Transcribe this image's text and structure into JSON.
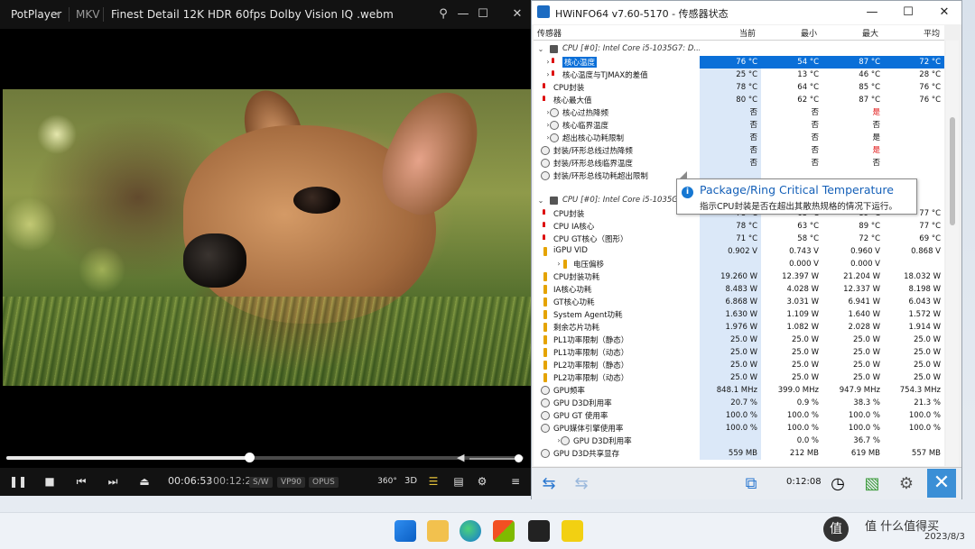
{
  "potplayer": {
    "brand": "PotPlayer",
    "format": "MKV",
    "filename": "Finest Detail 12K HDR 60fps  Dolby Vision IQ .webm",
    "time_current": "00:06:53",
    "time_total": "00:12:26",
    "tags": [
      "S/W",
      "VP90",
      "OPUS"
    ],
    "seek_fraction": 0.47,
    "volume_fraction": 1.0,
    "labels": {
      "vr": "360°",
      "td": "3D"
    }
  },
  "hwinfo": {
    "title": "HWiNFO64 v7.60-5170 - 传感器状态",
    "columns": {
      "sensor": "传感器",
      "current": "当前",
      "min": "最小",
      "max": "最大",
      "avg": "平均"
    },
    "group1": "CPU [#0]: Intel Core i5-1035G7: D...",
    "group2": "CPU [#0]: Intel Core i5-1035G",
    "rows_a": [
      {
        "label": "核心温度",
        "cur": "76 °C",
        "min": "54 °C",
        "max": "87 °C",
        "avg": "72 °C",
        "sel": true,
        "icon": "therm",
        "exp": true
      },
      {
        "label": "核心温度与TJMAX的差值",
        "cur": "25 °C",
        "min": "13 °C",
        "max": "46 °C",
        "avg": "28 °C",
        "icon": "therm",
        "exp": true
      },
      {
        "label": "CPU封装",
        "cur": "78 °C",
        "min": "64 °C",
        "max": "85 °C",
        "avg": "76 °C",
        "icon": "therm"
      },
      {
        "label": "核心最大值",
        "cur": "80 °C",
        "min": "62 °C",
        "max": "87 °C",
        "avg": "76 °C",
        "icon": "therm"
      },
      {
        "label": "核心过热降频",
        "cur": "否",
        "min": "否",
        "max": "是",
        "avg": "",
        "icon": "circle",
        "exp": true,
        "maxRed": true
      },
      {
        "label": "核心临界温度",
        "cur": "否",
        "min": "否",
        "max": "否",
        "avg": "",
        "icon": "circle",
        "exp": true
      },
      {
        "label": "超出核心功耗限制",
        "cur": "否",
        "min": "否",
        "max": "是",
        "avg": "",
        "icon": "circle",
        "exp": true
      },
      {
        "label": "封装/环形总线过热降频",
        "cur": "否",
        "min": "否",
        "max": "是",
        "avg": "",
        "icon": "circle",
        "maxRed": true
      },
      {
        "label": "封装/环形总线临界温度",
        "cur": "否",
        "min": "否",
        "max": "否",
        "avg": "",
        "icon": "circle"
      },
      {
        "label": "封装/环形总线功耗超出限制",
        "cur": "",
        "min": "",
        "max": "",
        "avg": "",
        "icon": "circle"
      }
    ],
    "rows_b": [
      {
        "label": "CPU封装",
        "cur": "78 °C",
        "min": "63 °C",
        "max": "89 °C",
        "avg": "77 °C",
        "icon": "therm"
      },
      {
        "label": "CPU IA核心",
        "cur": "78 °C",
        "min": "63 °C",
        "max": "89 °C",
        "avg": "77 °C",
        "icon": "therm"
      },
      {
        "label": "CPU GT核心（图形）",
        "cur": "71 °C",
        "min": "58 °C",
        "max": "72 °C",
        "avg": "69 °C",
        "icon": "therm"
      },
      {
        "label": "iGPU VID",
        "cur": "0.902 V",
        "min": "0.743 V",
        "max": "0.960 V",
        "avg": "0.868 V",
        "icon": "bolt"
      },
      {
        "label": "电压偏移",
        "cur": "",
        "min": "0.000 V",
        "max": "0.000 V",
        "avg": "",
        "icon": "bolt",
        "exp": true,
        "indent": true
      },
      {
        "label": "CPU封装功耗",
        "cur": "19.260 W",
        "min": "12.397 W",
        "max": "21.204 W",
        "avg": "18.032 W",
        "icon": "bolt"
      },
      {
        "label": "IA核心功耗",
        "cur": "8.483 W",
        "min": "4.028 W",
        "max": "12.337 W",
        "avg": "8.198 W",
        "icon": "bolt"
      },
      {
        "label": "GT核心功耗",
        "cur": "6.868 W",
        "min": "3.031 W",
        "max": "6.941 W",
        "avg": "6.043 W",
        "icon": "bolt"
      },
      {
        "label": "System Agent功耗",
        "cur": "1.630 W",
        "min": "1.109 W",
        "max": "1.640 W",
        "avg": "1.572 W",
        "icon": "bolt"
      },
      {
        "label": "剩余芯片功耗",
        "cur": "1.976 W",
        "min": "1.082 W",
        "max": "2.028 W",
        "avg": "1.914 W",
        "icon": "bolt"
      },
      {
        "label": "PL1功率限制（静态）",
        "cur": "25.0 W",
        "min": "25.0 W",
        "max": "25.0 W",
        "avg": "25.0 W",
        "icon": "bolt"
      },
      {
        "label": "PL1功率限制（动态）",
        "cur": "25.0 W",
        "min": "25.0 W",
        "max": "25.0 W",
        "avg": "25.0 W",
        "icon": "bolt"
      },
      {
        "label": "PL2功率限制（静态）",
        "cur": "25.0 W",
        "min": "25.0 W",
        "max": "25.0 W",
        "avg": "25.0 W",
        "icon": "bolt"
      },
      {
        "label": "PL2功率限制（动态）",
        "cur": "25.0 W",
        "min": "25.0 W",
        "max": "25.0 W",
        "avg": "25.0 W",
        "icon": "bolt"
      },
      {
        "label": "GPU频率",
        "cur": "848.1 MHz",
        "min": "399.0 MHz",
        "max": "947.9 MHz",
        "avg": "754.3 MHz",
        "icon": "circle"
      },
      {
        "label": "GPU D3D利用率",
        "cur": "20.7 %",
        "min": "0.9 %",
        "max": "38.3 %",
        "avg": "21.3 %",
        "icon": "circle"
      },
      {
        "label": "GPU GT 使用率",
        "cur": "100.0 %",
        "min": "100.0 %",
        "max": "100.0 %",
        "avg": "100.0 %",
        "icon": "circle"
      },
      {
        "label": "GPU媒体引擎使用率",
        "cur": "100.0 %",
        "min": "100.0 %",
        "max": "100.0 %",
        "avg": "100.0 %",
        "icon": "circle"
      },
      {
        "label": "GPU D3D利用率",
        "cur": "",
        "min": "0.0 %",
        "max": "36.7 %",
        "avg": "",
        "icon": "circle",
        "exp": true,
        "indent": true
      },
      {
        "label": "GPU D3D共享显存",
        "cur": "559 MB",
        "min": "212 MB",
        "max": "619 MB",
        "avg": "557 MB",
        "icon": "circle"
      }
    ],
    "tooltip": {
      "title": "Package/Ring Critical Temperature",
      "desc": "指示CPU封装是否在超出其散热规格的情况下运行。"
    },
    "elapsed": "0:12:08"
  },
  "taskbar": {
    "watermark": "值 什么值得买",
    "date": "2023/8/3"
  }
}
